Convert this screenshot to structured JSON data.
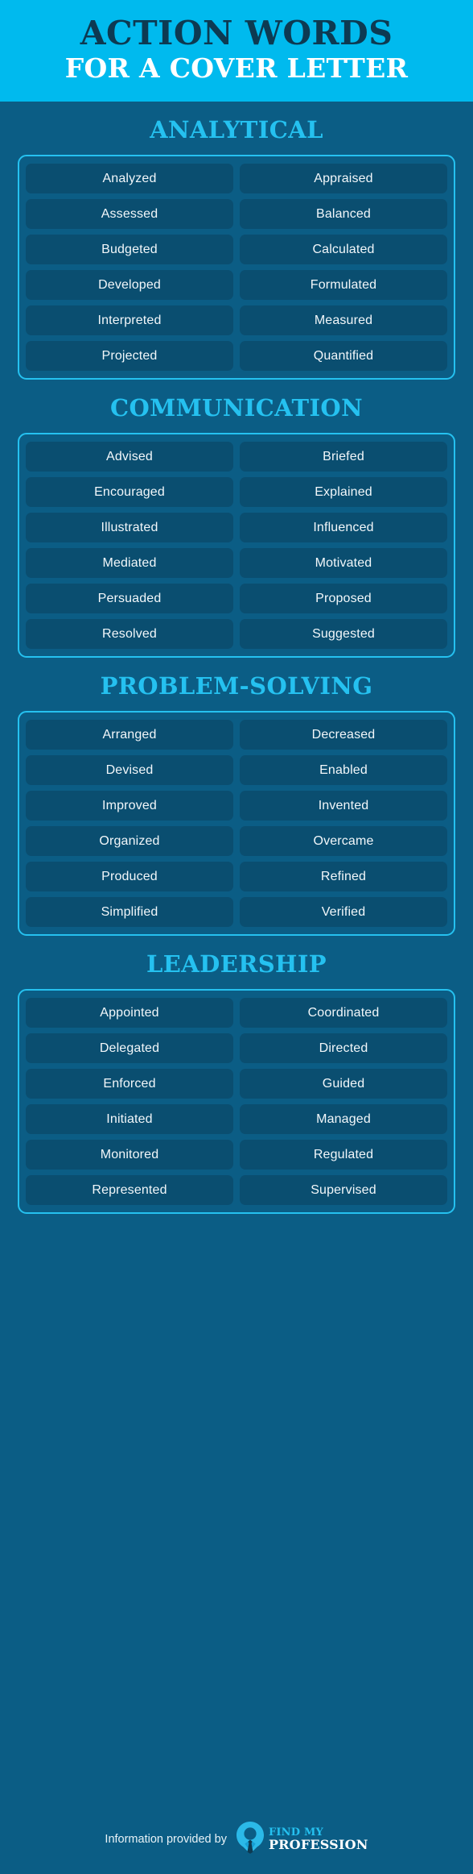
{
  "header": {
    "title": "ACTION WORDS",
    "subtitle": "FOR A COVER LETTER"
  },
  "colors": {
    "header_bg": "#00baee",
    "header_title": "#0d3a52",
    "header_subtitle": "#ffffff",
    "page_bg": "#0b5d85",
    "accent_cyan": "#25c1f0",
    "pill_bg": "#0a4e70",
    "pill_text": "#f2f7fa"
  },
  "sections": [
    {
      "heading": "ANALYTICAL",
      "words": [
        "Analyzed",
        "Appraised",
        "Assessed",
        "Balanced",
        "Budgeted",
        "Calculated",
        "Developed",
        "Formulated",
        "Interpreted",
        "Measured",
        "Projected",
        "Quantified"
      ]
    },
    {
      "heading": "COMMUNICATION",
      "words": [
        "Advised",
        "Briefed",
        "Encouraged",
        "Explained",
        "Illustrated",
        "Influenced",
        "Mediated",
        "Motivated",
        "Persuaded",
        "Proposed",
        "Resolved",
        "Suggested"
      ]
    },
    {
      "heading": "PROBLEM-SOLVING",
      "words": [
        "Arranged",
        "Decreased",
        "Devised",
        "Enabled",
        "Improved",
        "Invented",
        "Organized",
        "Overcame",
        "Produced",
        "Refined",
        "Simplified",
        "Verified"
      ]
    },
    {
      "heading": "LEADERSHIP",
      "words": [
        "Appointed",
        "Coordinated",
        "Delegated",
        "Directed",
        "Enforced",
        "Guided",
        "Initiated",
        "Managed",
        "Monitored",
        "Regulated",
        "Represented",
        "Supervised"
      ]
    }
  ],
  "footer": {
    "credit_text": "Information provided by",
    "logo": {
      "icon": "location-pin-person-tie-icon",
      "line1": "FIND MY",
      "line2": "PROFESSION"
    }
  }
}
